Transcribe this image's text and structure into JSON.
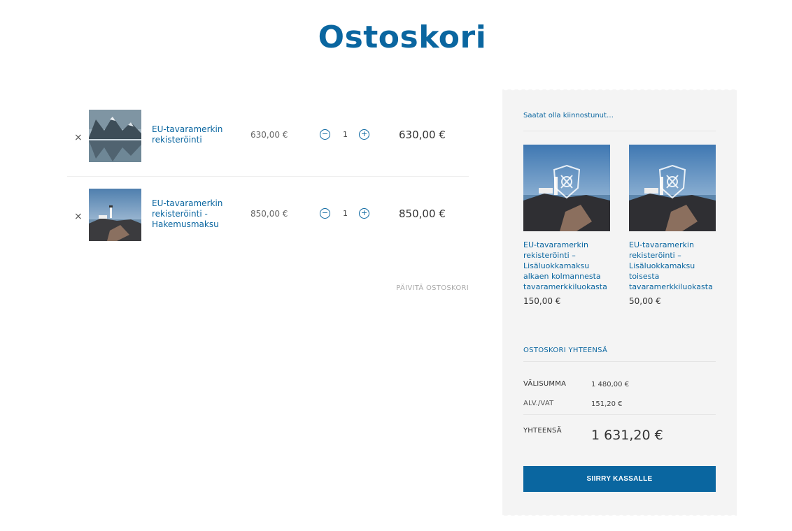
{
  "colors": {
    "accent": "#0a66a0",
    "sidebar_bg": "#f4f4f4"
  },
  "page": {
    "title": "Ostoskori"
  },
  "cart": {
    "items": [
      {
        "name": "EU-tavaramerkin rekisteröinti",
        "unit_price": "630,00 €",
        "quantity": "1",
        "line_total": "630,00 €",
        "image": "mountain-lake-photo"
      },
      {
        "name": "EU-tavaramerkin rekisteröinti - Hakemusmaksu",
        "unit_price": "850,00 €",
        "quantity": "1",
        "line_total": "850,00 €",
        "image": "lighthouse-photo"
      }
    ],
    "remove_icon": "×",
    "minus_icon": "−",
    "plus_icon": "+",
    "update_label": "PÄIVITÄ OSTOSKORI"
  },
  "sidebar": {
    "you_may_label": "Saatat olla kiinnostunut…",
    "recommendations": [
      {
        "name": "EU-tavaramerkin rekisteröinti – Lisäluokkamaksu alkaen kolmannesta tavaramerkkiluokasta",
        "price": "150,00 €",
        "image": "lighthouse-shield-photo"
      },
      {
        "name": "EU-tavaramerkin rekisteröinti – Lisäluokkamaksu toisesta tavaramerkkiluokasta",
        "price": "50,00 €",
        "image": "lighthouse-shield-photo"
      }
    ],
    "totals": {
      "title": "OSTOSKORI YHTEENSÄ",
      "subtotal_label": "VÄLISUMMA",
      "subtotal_value": "1 480,00 €",
      "vat_label": "ALV./VAT",
      "vat_value": "151,20 €",
      "total_label": "YHTEENSÄ",
      "total_value": "1 631,20 €"
    },
    "checkout_label": "SIIRRY KASSALLE"
  }
}
